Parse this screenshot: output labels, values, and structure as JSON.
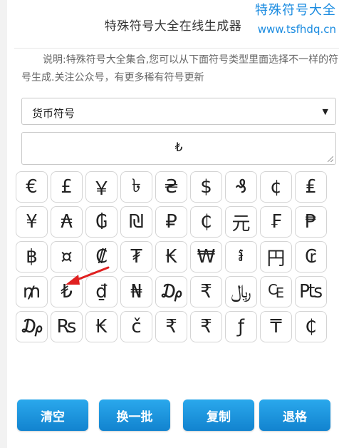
{
  "title": "特殊符号大全在线生成器",
  "watermark": {
    "line1": "特殊符号大全",
    "line2": "www.tsfhdq.cn"
  },
  "description": "说明:特殊符号大全集合,您可以从下面符号类型里面选择不一样的符号生成.关注公众号，有更多稀有符号更新",
  "select": {
    "value": "货币符号"
  },
  "output": {
    "value": "₺"
  },
  "symbols": [
    "€",
    "£",
    "￥",
    "৳",
    "₴",
    "$",
    "₰",
    "¢",
    "₤",
    "¥",
    "₳",
    "₲",
    "₪",
    "₽",
    "₵",
    "元",
    "₣",
    "₱",
    "฿",
    "¤",
    "₡",
    "₮",
    "₭",
    "₩",
    "៛",
    "円",
    "₢",
    "₥",
    "₺",
    "₫",
    "₦",
    "₯",
    "₹",
    "﷼",
    "₠",
    "₧",
    "₯",
    "₨",
    "₭",
    "č",
    "₹",
    "₹",
    "ƒ",
    "₸",
    "₵"
  ],
  "buttons": {
    "clear": "清空",
    "refresh": "换一批",
    "copy": "复制",
    "backspace": "退格"
  },
  "colors": {
    "button": "#1a95e0",
    "watermark": "#1a8be0",
    "arrow": "#e02020"
  }
}
